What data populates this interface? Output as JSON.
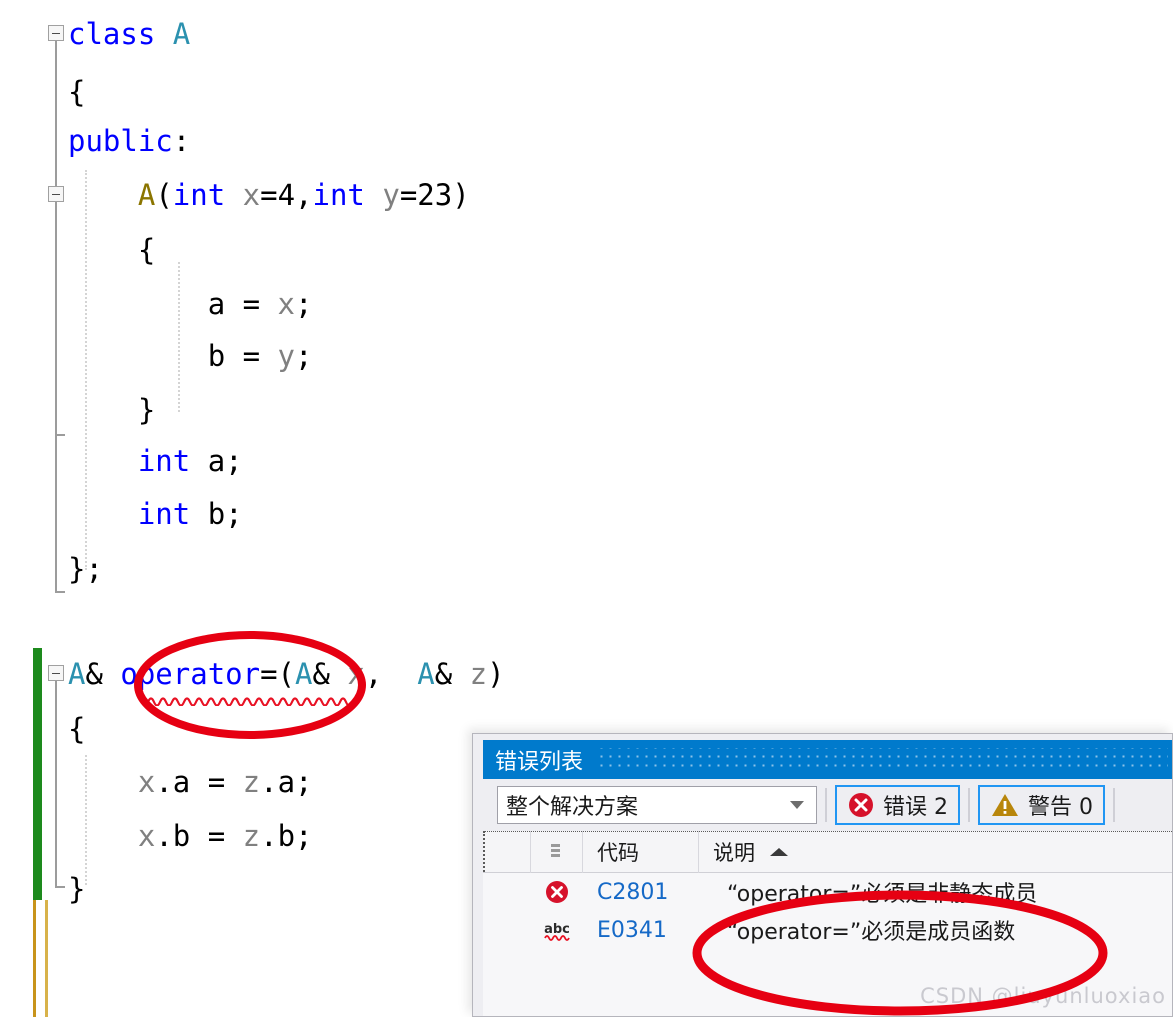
{
  "editor": {
    "lines": [
      {
        "indent": 0,
        "tokens": [
          {
            "t": "class ",
            "c": "kw"
          },
          {
            "t": "A",
            "c": "typ"
          }
        ]
      },
      {
        "indent": 0,
        "tokens": [
          {
            "t": "{",
            "c": "plain"
          }
        ]
      },
      {
        "indent": 0,
        "tokens": [
          {
            "t": "public",
            "c": "kw"
          },
          {
            "t": ":",
            "c": "plain"
          }
        ]
      },
      {
        "indent": 1,
        "tokens": [
          {
            "t": "A",
            "c": "ctor"
          },
          {
            "t": "(",
            "c": "plain"
          },
          {
            "t": "int",
            "c": "kw"
          },
          {
            "t": " ",
            "c": "plain"
          },
          {
            "t": "x",
            "c": "var"
          },
          {
            "t": "=4,",
            "c": "plain"
          },
          {
            "t": "int",
            "c": "kw"
          },
          {
            "t": " ",
            "c": "plain"
          },
          {
            "t": "y",
            "c": "var"
          },
          {
            "t": "=23)",
            "c": "plain"
          }
        ]
      },
      {
        "indent": 1,
        "tokens": [
          {
            "t": "{",
            "c": "plain"
          }
        ]
      },
      {
        "indent": 2,
        "tokens": [
          {
            "t": "a",
            "c": "plain"
          },
          {
            "t": " = ",
            "c": "plain"
          },
          {
            "t": "x",
            "c": "var"
          },
          {
            "t": ";",
            "c": "plain"
          }
        ]
      },
      {
        "indent": 2,
        "tokens": [
          {
            "t": "b",
            "c": "plain"
          },
          {
            "t": " = ",
            "c": "plain"
          },
          {
            "t": "y",
            "c": "var"
          },
          {
            "t": ";",
            "c": "plain"
          }
        ]
      },
      {
        "indent": 1,
        "tokens": [
          {
            "t": "}",
            "c": "plain"
          }
        ]
      },
      {
        "indent": 1,
        "tokens": [
          {
            "t": "int",
            "c": "kw"
          },
          {
            "t": " a;",
            "c": "plain"
          }
        ]
      },
      {
        "indent": 1,
        "tokens": [
          {
            "t": "int",
            "c": "kw"
          },
          {
            "t": " b;",
            "c": "plain"
          }
        ]
      },
      {
        "indent": 0,
        "tokens": [
          {
            "t": "};",
            "c": "plain"
          }
        ]
      },
      {
        "indent": 0,
        "tokens": []
      },
      {
        "indent": 0,
        "tokens": [
          {
            "t": "A",
            "c": "typ"
          },
          {
            "t": "& ",
            "c": "plain"
          },
          {
            "t": "operator",
            "c": "kw"
          },
          {
            "t": "=(",
            "c": "plain"
          },
          {
            "t": "A",
            "c": "typ"
          },
          {
            "t": "& ",
            "c": "plain"
          },
          {
            "t": "x",
            "c": "var"
          },
          {
            "t": ",  ",
            "c": "plain"
          },
          {
            "t": "A",
            "c": "typ"
          },
          {
            "t": "& ",
            "c": "plain"
          },
          {
            "t": "z",
            "c": "var"
          },
          {
            "t": ")",
            "c": "plain"
          }
        ]
      },
      {
        "indent": 0,
        "tokens": [
          {
            "t": "{",
            "c": "plain"
          }
        ]
      },
      {
        "indent": 1,
        "tokens": [
          {
            "t": "x",
            "c": "var"
          },
          {
            "t": ".",
            "c": "plain"
          },
          {
            "t": "a",
            "c": "plain"
          },
          {
            "t": " = ",
            "c": "plain"
          },
          {
            "t": "z",
            "c": "var"
          },
          {
            "t": ".",
            "c": "plain"
          },
          {
            "t": "a;",
            "c": "plain"
          }
        ]
      },
      {
        "indent": 1,
        "tokens": [
          {
            "t": "x",
            "c": "var"
          },
          {
            "t": ".",
            "c": "plain"
          },
          {
            "t": "b",
            "c": "plain"
          },
          {
            "t": " = ",
            "c": "plain"
          },
          {
            "t": "z",
            "c": "var"
          },
          {
            "t": ".",
            "c": "plain"
          },
          {
            "t": "b;",
            "c": "plain"
          }
        ]
      },
      {
        "indent": 0,
        "tokens": [
          {
            "t": "}",
            "c": "plain"
          }
        ]
      }
    ],
    "colors": {
      "keyword": "#0000ff",
      "type": "#2b91af",
      "constructor": "#8b7500",
      "variable": "#808080",
      "plain": "#000000",
      "squiggle": "#e81123",
      "change_bar_saved": "#1d8a1d",
      "change_bar_unsaved": "#c8941b",
      "annotation": "#e60012"
    }
  },
  "error_list": {
    "title": "错误列表",
    "scope": {
      "value": "整个解决方案",
      "caret_icon": "chevron-down-icon"
    },
    "counters": [
      {
        "icon": "error-circle-icon",
        "label": "错误 2",
        "color": "#d6122b"
      },
      {
        "icon": "warning-triangle-icon",
        "label": "警告 0",
        "color": "#b8860b"
      }
    ],
    "columns": [
      {
        "key": "select",
        "label": ""
      },
      {
        "key": "severity",
        "label": ""
      },
      {
        "key": "code",
        "label": "代码"
      },
      {
        "key": "description",
        "label": "说明",
        "sort": "asc",
        "sort_icon": "sort-ascending-icon"
      }
    ],
    "rows": [
      {
        "icon": "error-circle-icon",
        "code": "C2801",
        "description": "“operator=”必须是非静态成员"
      },
      {
        "icon": "intellisense-abc-icon",
        "code": "E0341",
        "description": "“operator=”必须是成员函数"
      }
    ]
  },
  "watermark": {
    "text": "CSDN @liuyunluoxiao"
  },
  "annotations": [
    {
      "name": "ellipse-operator-in-code"
    },
    {
      "name": "ellipse-error-row-description"
    }
  ]
}
